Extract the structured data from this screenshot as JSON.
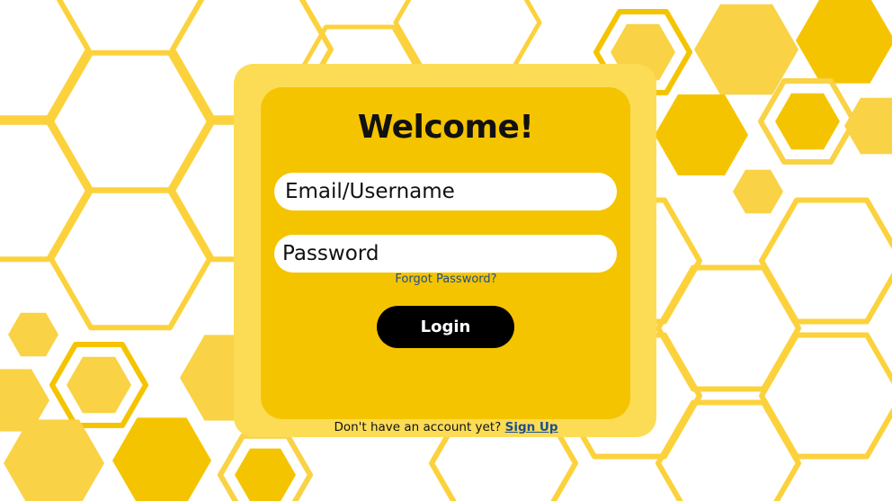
{
  "colors": {
    "background": "#ffffff",
    "outer_card": "#fcdc55",
    "inner_card": "#f5c400",
    "honeycomb_fill": "#f5c400",
    "honeycomb_fill_light": "#f9d245",
    "honeycomb_outline": "#fcd23c",
    "button": "#000000",
    "link": "#1d4f8f"
  },
  "background": {
    "pattern": "honeycomb-hexagons"
  },
  "login": {
    "title": "Welcome!",
    "email_placeholder": "Email/Username",
    "password_placeholder": "Password",
    "forgot_label": "Forgot Password?",
    "login_label": "Login",
    "signup_prompt": "Don't have an account yet?",
    "signup_label": "Sign Up"
  }
}
